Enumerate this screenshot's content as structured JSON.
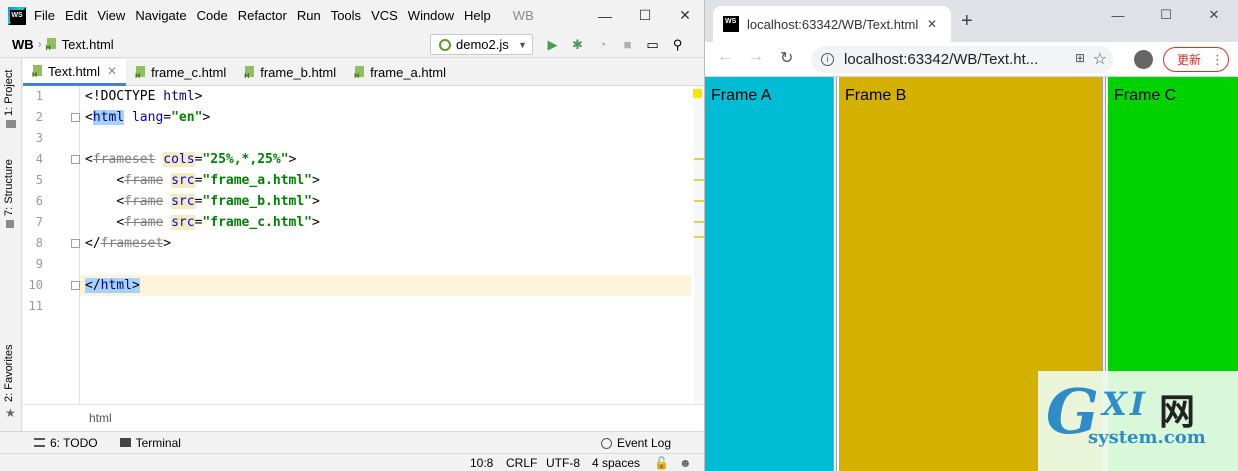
{
  "ide": {
    "logo": "WS",
    "menu": [
      "File",
      "Edit",
      "View",
      "Navigate",
      "Code",
      "Refactor",
      "Run",
      "Tools",
      "VCS",
      "Window",
      "Help"
    ],
    "project_title": "WB",
    "window_controls": {
      "minimize": "—",
      "maximize": "☐",
      "close": "✕"
    },
    "breadcrumb_project": "WB",
    "breadcrumb_file": "Text.html",
    "run_config": "demo2.js",
    "side_tabs": {
      "project": "1: Project",
      "structure": "7: Structure",
      "favorites": "2: Favorites"
    },
    "tabs": [
      {
        "label": "Text.html",
        "active": true
      },
      {
        "label": "frame_c.html",
        "active": false
      },
      {
        "label": "frame_b.html",
        "active": false
      },
      {
        "label": "frame_a.html",
        "active": false
      }
    ],
    "line_numbers": [
      "1",
      "2",
      "3",
      "4",
      "5",
      "6",
      "7",
      "8",
      "9",
      "10",
      "11"
    ],
    "code": {
      "l1_doctype": "<!DOCTYPE ",
      "l1_html": "html",
      "l1_close": ">",
      "l2_open": "<",
      "l2_tag": "html",
      "l2_attr": " lang",
      "l2_eq": "=",
      "l2_val": "\"en\"",
      "l2_close": ">",
      "l4_open": "<",
      "l4_tag": "frameset",
      "l4_attr": "cols",
      "l4_eq": "=",
      "l4_val": "\"25%,*,25%\"",
      "l4_close": ">",
      "frame_open": "<",
      "frame_tag": "frame",
      "frame_attr": "src",
      "frame_eq": "=",
      "l5_val": "\"frame_a.html\"",
      "l6_val": "\"frame_b.html\"",
      "l7_val": "\"frame_c.html\"",
      "frame_close": ">",
      "l8_open": "</",
      "l8_tag": "frameset",
      "l8_close": ">",
      "l10_open": "</",
      "l10_tag": "html",
      "l10_close": ">"
    },
    "editor_breadcrumb": "html",
    "toolwindows": {
      "todo": "6: TODO",
      "terminal": "Terminal",
      "event_log": "Event Log"
    },
    "status": {
      "position": "10:8",
      "line_sep": "CRLF",
      "encoding": "UTF-8",
      "indent": "4 spaces"
    }
  },
  "browser": {
    "tab_title": "localhost:63342/WB/Text.html",
    "tab_close": "✕",
    "new_tab": "+",
    "window_controls": {
      "minimize": "—",
      "maximize": "☐",
      "close": "✕"
    },
    "url": "localhost:63342/WB/Text.ht...",
    "update_label": "更新",
    "frames": [
      {
        "label": "Frame A",
        "color": "#00bcd4"
      },
      {
        "label": "Frame B",
        "color": "#d4b000"
      },
      {
        "label": "Frame C",
        "color": "#00d200"
      }
    ]
  },
  "watermark": {
    "g": "G",
    "xi": "XI",
    "cn": "网",
    "site": "system.com"
  },
  "colors": {
    "accent": "#4083c9",
    "tag_highlight": "#a6d2ff",
    "caret_line": "#fcf5db",
    "update_red": "#d93025"
  }
}
